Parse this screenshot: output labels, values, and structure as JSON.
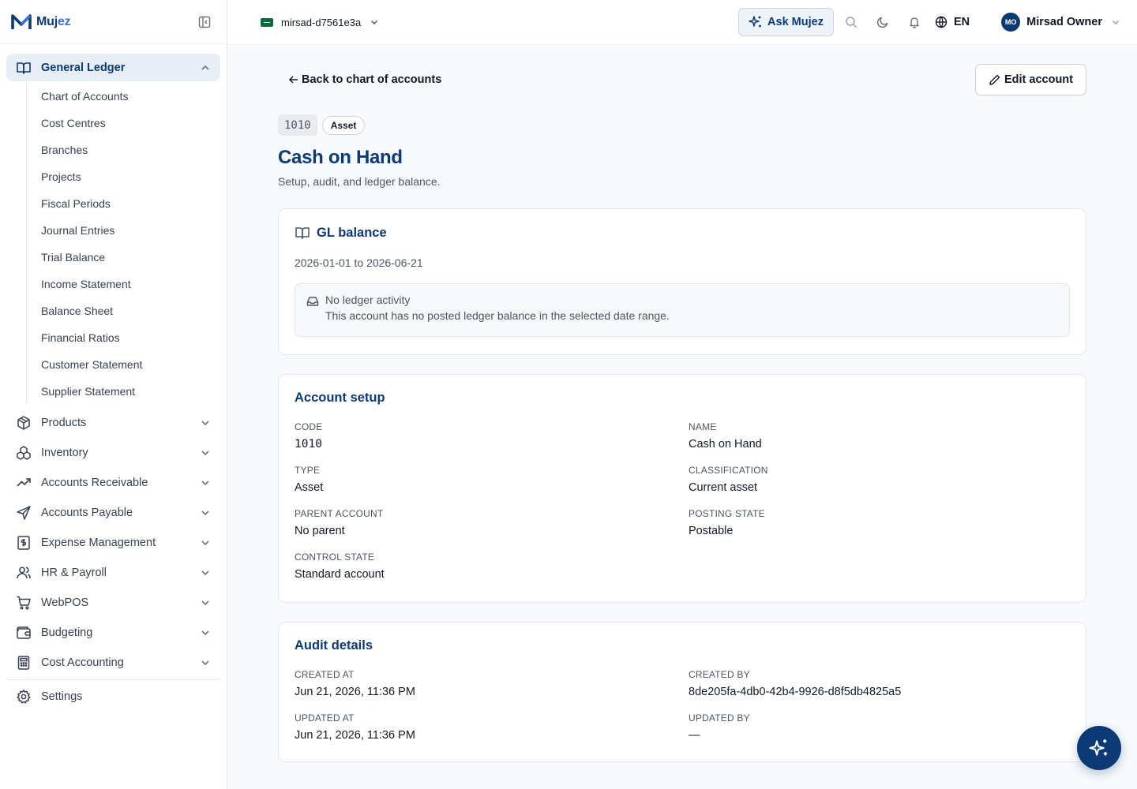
{
  "brand": {
    "name_main": "Muj",
    "name_accent": "ez"
  },
  "sidebar": {
    "group": {
      "label": "General Ledger",
      "items": [
        "Chart of Accounts",
        "Cost Centres",
        "Branches",
        "Projects",
        "Fiscal Periods",
        "Journal Entries",
        "Trial Balance",
        "Income Statement",
        "Balance Sheet",
        "Financial Ratios",
        "Customer Statement",
        "Supplier Statement"
      ]
    },
    "modules": [
      {
        "label": "Products",
        "icon": "package-icon"
      },
      {
        "label": "Inventory",
        "icon": "boxes-icon"
      },
      {
        "label": "Accounts Receivable",
        "icon": "trending-up-icon"
      },
      {
        "label": "Accounts Payable",
        "icon": "send-icon"
      },
      {
        "label": "Expense Management",
        "icon": "receipt-dollar-icon"
      },
      {
        "label": "HR & Payroll",
        "icon": "users-icon"
      },
      {
        "label": "WebPOS",
        "icon": "cart-icon"
      },
      {
        "label": "Budgeting",
        "icon": "wallet-icon"
      },
      {
        "label": "Cost Accounting",
        "icon": "calculator-icon"
      }
    ],
    "settings": "Settings"
  },
  "topbar": {
    "org": "mirsad-d7561e3a",
    "ask": "Ask Mujez",
    "lang": "EN",
    "avatar": "MO",
    "user": "Mirsad Owner"
  },
  "page": {
    "back": "Back to chart of accounts",
    "edit": "Edit account",
    "code": "1010",
    "type": "Asset",
    "title": "Cash on Hand",
    "subtitle": "Setup, audit, and ledger balance."
  },
  "gl": {
    "title": "GL balance",
    "range": "2026-01-01 to 2026-06-21",
    "empty_title": "No ledger activity",
    "empty_text": "This account has no posted ledger balance in the selected date range."
  },
  "setup": {
    "title": "Account setup",
    "fields": [
      {
        "label": "Code",
        "value": "1010"
      },
      {
        "label": "Name",
        "value": "Cash on Hand"
      },
      {
        "label": "Type",
        "value": "Asset"
      },
      {
        "label": "Classification",
        "value": "Current asset"
      },
      {
        "label": "Parent account",
        "value": "No parent"
      },
      {
        "label": "Posting state",
        "value": "Postable"
      },
      {
        "label": "Control state",
        "value": "Standard account"
      }
    ]
  },
  "audit": {
    "title": "Audit details",
    "fields": [
      {
        "label": "Created at",
        "value": "Jun 21, 2026, 11:36 PM"
      },
      {
        "label": "Created by",
        "value": "8de205fa-4db0-42b4-9926-d8f5db4825a5"
      },
      {
        "label": "Updated at",
        "value": "Jun 21, 2026, 11:36 PM"
      },
      {
        "label": "Updated by",
        "value": "—"
      }
    ]
  },
  "colors": {
    "brand": "#0b3a75",
    "accent": "#3b6fd8",
    "active_bg": "#e8eef6"
  }
}
